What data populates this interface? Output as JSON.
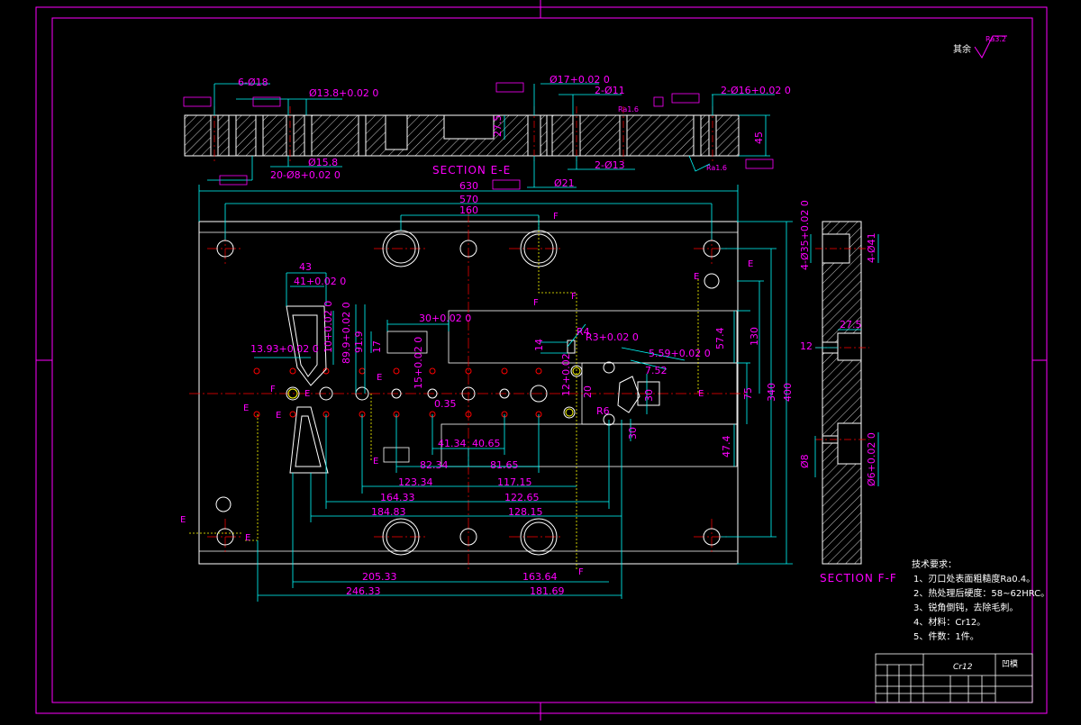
{
  "colors": {
    "background": "#000000",
    "frame": "#ff00ff",
    "outline": "#ffffff",
    "dimension": "#00ffff",
    "center_line": "#ff0000",
    "hatch": "#ffffff",
    "hidden_line": "#ffff00",
    "text": "#ff00ff"
  },
  "roughness": {
    "prefix": "其余",
    "value": "Ra3.2"
  },
  "section_ee": {
    "title": "SECTION E-E",
    "dims": [
      "6-Ø18",
      "Ø13.8+0.02 0",
      "Ø15.8",
      "20-Ø8+0.02 0",
      "Ø17+0.02 0",
      "2-Ø11",
      "27.5",
      "Ra1.6",
      "2-Ø13",
      "Ø21",
      "2-Ø16+0.02 0",
      "45",
      "Ra1.6"
    ]
  },
  "top_view": {
    "dims_top": [
      "630",
      "570",
      "160"
    ],
    "left_feature": [
      "43",
      "41+0.02 0",
      "10+0.02 0",
      "89.9+0.02 0",
      "91.9",
      "13.93+0.02 0"
    ],
    "mid_feature": [
      "30+0.02 0",
      "17",
      "14",
      "15+0.02 0",
      "0.35",
      "R4",
      "R3+0.02 0",
      "12+0.02",
      "R6",
      "20"
    ],
    "right_feature": [
      "5.59+0.02 0",
      "7.52",
      "30",
      "30",
      "57.4",
      "130",
      "75",
      "340",
      "400",
      "47.4"
    ],
    "dims_bottom_row1": [
      "41.34",
      "40.65"
    ],
    "dims_bottom_row2": [
      "82.34",
      "81.65"
    ],
    "dims_bottom_row3": [
      "123.34",
      "117.15"
    ],
    "dims_bottom_row4": [
      "164.33",
      "122.65"
    ],
    "dims_bottom_row5": [
      "184.83",
      "128.15"
    ],
    "dims_bottom_row6": [
      "205.33",
      "163.64"
    ],
    "dims_bottom_row7": [
      "246.33",
      "181.69"
    ]
  },
  "section_ff": {
    "title": "SECTION F-F",
    "dims": [
      "4-Ø35+0.02 0",
      "4-Ø41",
      "27.5",
      "12",
      "Ø8",
      "Ø6+0.02 0"
    ]
  },
  "notes": {
    "heading": "技术要求：",
    "items": [
      "1、刃口处表面粗糙度Ra0.4。",
      "2、热处理后硬度：58~62HRC。",
      "3、锐角倒钝，去除毛刺。",
      "4、材料：Cr12。",
      "5、件数：1件。"
    ]
  },
  "title_block": {
    "material": "Cr12",
    "part_name": "凹模"
  }
}
